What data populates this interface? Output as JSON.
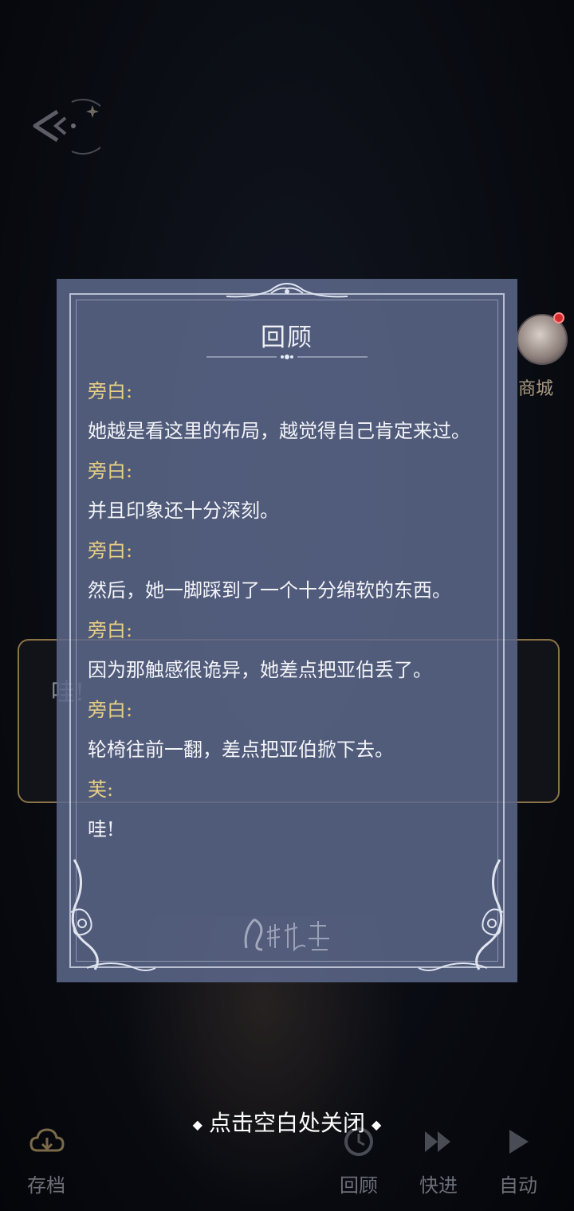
{
  "shop": {
    "label": "商城"
  },
  "dialog": {
    "text": "哇!"
  },
  "review": {
    "title": "回顾",
    "entries": [
      {
        "speaker": "旁白:",
        "text": "她越是看这里的布局，越觉得自己肯定来过。"
      },
      {
        "speaker": "旁白:",
        "text": "并且印象还十分深刻。"
      },
      {
        "speaker": "旁白:",
        "text": "然后，她一脚踩到了一个十分绵软的东西。"
      },
      {
        "speaker": "旁白:",
        "text": "因为那触感很诡异，她差点把亚伯丢了。"
      },
      {
        "speaker": "旁白:",
        "text": "轮椅往前一翻，差点把亚伯掀下去。"
      },
      {
        "speaker": "芙:",
        "text": "哇!"
      }
    ],
    "watermark": "月影别墅"
  },
  "close_hint": "点击空白处关闭",
  "toolbar": {
    "save": "存档",
    "review": "回顾",
    "fast_forward": "快进",
    "auto": "自动"
  },
  "icons": {
    "back": "back-arrow-icon",
    "save": "cloud-save-icon",
    "review": "history-icon",
    "fast_forward": "fast-forward-icon",
    "auto": "play-icon"
  },
  "colors": {
    "panel": "#5c688a",
    "speaker": "#e7cf85",
    "text": "#f3f4f8",
    "dialog_border": "#8a7346"
  }
}
